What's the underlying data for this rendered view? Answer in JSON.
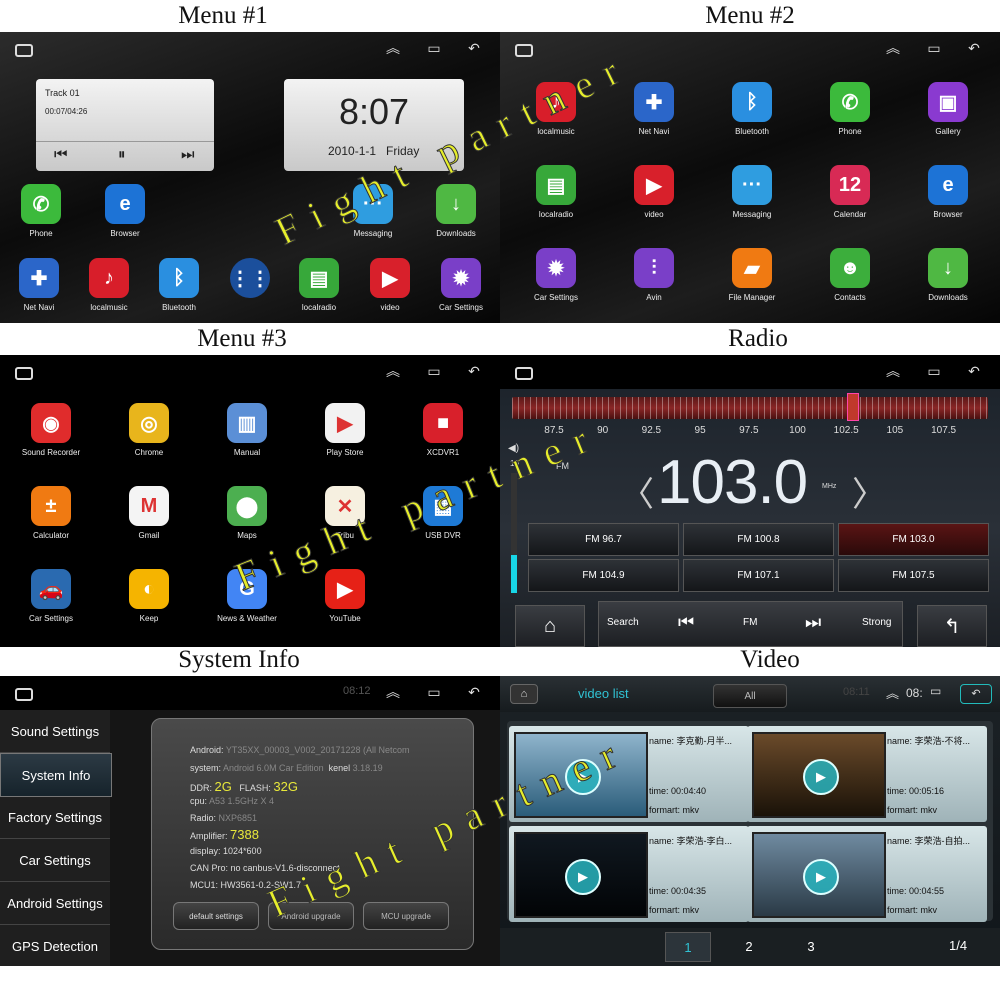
{
  "captions": {
    "menu1": "Menu #1",
    "menu2": "Menu #2",
    "menu3": "Menu #3",
    "radio": "Radio",
    "sysinfo": "System Info",
    "video": "Video"
  },
  "watermark": "Fight partner",
  "icons": {
    "home": "home-outline-icon",
    "up": "chevron-up-icon",
    "recent": "recent-apps-icon",
    "back": "back-arrow-icon"
  },
  "menu1": {
    "music": {
      "track": "Track 01",
      "time": "00:07/04:26"
    },
    "clock": {
      "time": "8:07",
      "date": "2010-1-1",
      "day": "Friday"
    },
    "row1": [
      {
        "label": "Phone",
        "icon": "phone-icon",
        "glyph": "✆",
        "color": "#3cba3c"
      },
      {
        "label": "Browser",
        "icon": "browser-icon",
        "glyph": "e",
        "color": "#1d73d6"
      },
      {
        "label": "Messaging",
        "icon": "messaging-icon",
        "glyph": "···",
        "color": "#2f9de0"
      },
      {
        "label": "Downloads",
        "icon": "downloads-icon",
        "glyph": "↓",
        "color": "#4fb843"
      }
    ],
    "row2": [
      {
        "label": "Net Navi",
        "icon": "navigation-icon",
        "glyph": "✚",
        "color": "#2b66c9"
      },
      {
        "label": "localmusic",
        "icon": "music-icon",
        "glyph": "♪",
        "color": "#d81e2a"
      },
      {
        "label": "Bluetooth",
        "icon": "bluetooth-icon",
        "glyph": "ᛒ",
        "color": "#2a8fe0"
      },
      {
        "label": "",
        "icon": "apps-grid-icon",
        "glyph": "⋮⋮",
        "color": "#1b4f9c"
      },
      {
        "label": "localradio",
        "icon": "radio-icon",
        "glyph": "▤",
        "color": "#37a83a"
      },
      {
        "label": "video",
        "icon": "video-play-icon",
        "glyph": "▶",
        "color": "#d8202b"
      },
      {
        "label": "Car Settings",
        "icon": "gear-icon",
        "glyph": "✹",
        "color": "#7a3fc8"
      }
    ]
  },
  "menu2": {
    "apps": [
      {
        "label": "localmusic",
        "icon": "music-icon",
        "glyph": "♪",
        "color": "#d81e2a"
      },
      {
        "label": "Net Navi",
        "icon": "navigation-icon",
        "glyph": "✚",
        "color": "#2b66c9"
      },
      {
        "label": "Bluetooth",
        "icon": "bluetooth-icon",
        "glyph": "ᛒ",
        "color": "#2a8fe0"
      },
      {
        "label": "Phone",
        "icon": "phone-icon",
        "glyph": "✆",
        "color": "#3cba3c"
      },
      {
        "label": "Gallery",
        "icon": "gallery-icon",
        "glyph": "▣",
        "color": "#8a3ad0"
      },
      {
        "label": "localradio",
        "icon": "radio-icon",
        "glyph": "▤",
        "color": "#37a83a"
      },
      {
        "label": "video",
        "icon": "video-play-icon",
        "glyph": "▶",
        "color": "#d8202b"
      },
      {
        "label": "Messaging",
        "icon": "messaging-icon",
        "glyph": "···",
        "color": "#2f9de0"
      },
      {
        "label": "Calendar",
        "icon": "calendar-icon",
        "glyph": "12",
        "color": "#d82a55"
      },
      {
        "label": "Browser",
        "icon": "browser-icon",
        "glyph": "e",
        "color": "#1d73d6"
      },
      {
        "label": "Car Settings",
        "icon": "gear-icon",
        "glyph": "✹",
        "color": "#7a3fc8"
      },
      {
        "label": "Avin",
        "icon": "equalizer-icon",
        "glyph": "⫶",
        "color": "#7a3fc8"
      },
      {
        "label": "File Manager",
        "icon": "folder-icon",
        "glyph": "▰",
        "color": "#f07a12"
      },
      {
        "label": "Contacts",
        "icon": "contacts-icon",
        "glyph": "☻",
        "color": "#3cae3c"
      },
      {
        "label": "Downloads",
        "icon": "downloads-icon",
        "glyph": "↓",
        "color": "#4fb843"
      }
    ]
  },
  "menu3": {
    "apps": [
      {
        "label": "Sound Recorder",
        "icon": "microphone-record-icon",
        "glyph": "◉",
        "color": "#e02c2c"
      },
      {
        "label": "Chrome",
        "icon": "chrome-icon",
        "glyph": "◎",
        "color": "#e8b51c"
      },
      {
        "label": "Manual",
        "icon": "manual-book-icon",
        "glyph": "▥",
        "color": "#5b8fd6"
      },
      {
        "label": "Play Store",
        "icon": "play-store-icon",
        "glyph": "▶",
        "color": "#f2f2f2"
      },
      {
        "label": "XCDVR1",
        "icon": "dvr-camera-icon",
        "glyph": "■",
        "color": "#d8202b"
      },
      {
        "label": "Calculator",
        "icon": "calculator-icon",
        "glyph": "±",
        "color": "#f07a12"
      },
      {
        "label": "Gmail",
        "icon": "gmail-icon",
        "glyph": "M",
        "color": "#f4f4f4"
      },
      {
        "label": "Maps",
        "icon": "maps-icon",
        "glyph": "⬤",
        "color": "#4caf50"
      },
      {
        "label": "Tribu",
        "icon": "tribu-icon",
        "glyph": "✕",
        "color": "#f6f0e0"
      },
      {
        "label": "USB DVR",
        "icon": "usb-dvr-icon",
        "glyph": "▦",
        "color": "#1e7ad6"
      },
      {
        "label": "Car Settings",
        "icon": "car-settings-icon",
        "glyph": "🚗",
        "color": "#2a6ab0"
      },
      {
        "label": "Keep",
        "icon": "keep-bulb-icon",
        "glyph": "◐",
        "color": "#f5b400"
      },
      {
        "label": "News & Weather",
        "icon": "news-icon",
        "glyph": "G",
        "color": "#4285f4"
      },
      {
        "label": "YouTube",
        "icon": "youtube-icon",
        "glyph": "▶",
        "color": "#e62117"
      }
    ]
  },
  "radio": {
    "scale": [
      "87.5",
      "90",
      "92.5",
      "95",
      "97.5",
      "100",
      "102.5",
      "105",
      "107.5"
    ],
    "band": "FM",
    "freq": "103.0",
    "unit": "MHz",
    "volume": "10",
    "presets": [
      "FM 96.7",
      "FM 100.8",
      "FM 103.0",
      "FM 104.9",
      "FM 107.1",
      "FM 107.5"
    ],
    "controls": {
      "search": "Search",
      "band": "FM",
      "strong": "Strong"
    },
    "active_color": "#5a1414"
  },
  "sysinfo": {
    "time": "08:12",
    "menu": [
      "Sound Settings",
      "System Info",
      "Factory Settings",
      "Car Settings",
      "Android Settings",
      "GPS Detection"
    ],
    "lines": {
      "android": {
        "k": "Android:",
        "v": "YT35XX_00003_V002_20171228  (All Netcom"
      },
      "system": {
        "k": "system:",
        "v": "Android 6.0M Car Edition",
        "k2": "kenel",
        "v2": "3.18.19"
      },
      "ddr": {
        "k": "DDR:",
        "v": "2G",
        "k2": "FLASH:",
        "v2": "32G"
      },
      "cpu": {
        "k": "cpu:",
        "v": "A53 1.5GHz X 4"
      },
      "radio": {
        "k": "Radio:",
        "v": "NXP6851"
      },
      "amp": {
        "k": "Amplifier:",
        "v": "7388"
      },
      "display": {
        "k": "display:",
        "v": "1024*600"
      },
      "canpro": {
        "k": "CAN Pro:",
        "v": "no canbus-V1.6-disconnect"
      },
      "mcu": {
        "k": "MCU1:",
        "v": "HW3561-0.2-SW1.7"
      }
    },
    "buttons": [
      "default settings",
      "Android upgrade",
      "MCU upgrade"
    ]
  },
  "video": {
    "title": "video list",
    "filter": "All",
    "time": "08:11",
    "time2": "08:",
    "items": [
      {
        "name": "name:  李克勤-月半...",
        "time": "time:  00:04:40",
        "format": "formart:  mkv"
      },
      {
        "name": "name:  李荣浩-不将...",
        "time": "time:  00:05:16",
        "format": "formart:  mkv"
      },
      {
        "name": "name:  李荣浩-李白...",
        "time": "time:  00:04:35",
        "format": "formart:  mkv"
      },
      {
        "name": "name:  李荣浩-自拍...",
        "time": "time:  00:04:55",
        "format": "formart:  mkv"
      }
    ],
    "pages": [
      "1",
      "2",
      "3"
    ],
    "page_count": "1/4"
  }
}
